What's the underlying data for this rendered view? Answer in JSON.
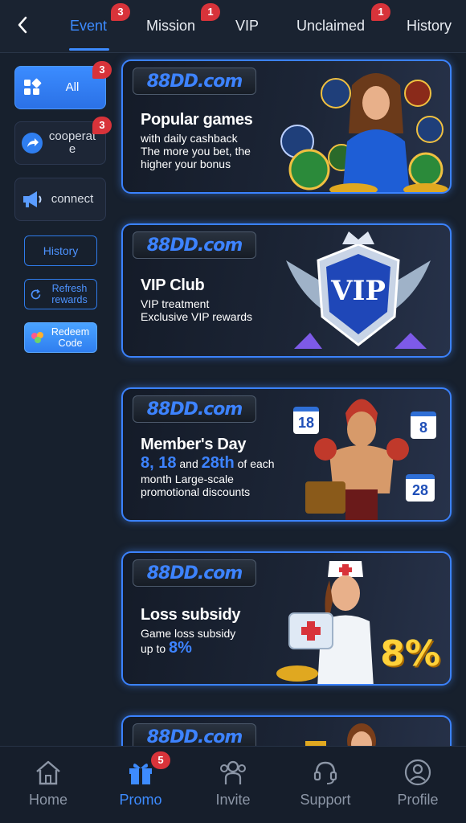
{
  "tabs": [
    {
      "label": "Event",
      "badge": "3"
    },
    {
      "label": "Mission",
      "badge": "1"
    },
    {
      "label": "VIP"
    },
    {
      "label": "Unclaimed",
      "badge": "1"
    },
    {
      "label": "History"
    }
  ],
  "sidebar": {
    "items": [
      {
        "label": "All",
        "badge": "3"
      },
      {
        "label": "cooperat e",
        "badge": "3"
      },
      {
        "label": "connect"
      }
    ],
    "history_label": "History",
    "refresh_label": "Refresh rewards",
    "redeem_label": "Redeem Code"
  },
  "banners": [
    {
      "logo": "88DD.com",
      "title": "Popular games",
      "lines": [
        "with daily cashback",
        "The more you bet, the",
        "higher your bonus"
      ]
    },
    {
      "logo": "88DD.com",
      "title": "VIP Club",
      "lines": [
        "VIP treatment",
        "Exclusive VIP rewards"
      ],
      "art_text": "VIP"
    },
    {
      "logo": "88DD.com",
      "title": "Member's Day",
      "line1_a": "8, 18",
      "line1_b": "and",
      "line1_c": "28th",
      "line1_d": "of each",
      "lines": [
        "month Large-scale",
        "promotional discounts"
      ],
      "dates": [
        "18",
        "8",
        "28"
      ]
    },
    {
      "logo": "88DD.com",
      "title": "Loss subsidy",
      "lines": [
        "Game loss subsidy"
      ],
      "line2_a": "up to",
      "line2_b": "8%",
      "art_text": "8%"
    },
    {
      "logo": "88DD.com"
    }
  ],
  "bottom_nav": [
    {
      "label": "Home"
    },
    {
      "label": "Promo",
      "badge": "5"
    },
    {
      "label": "Invite"
    },
    {
      "label": "Support"
    },
    {
      "label": "Profile"
    }
  ],
  "colors": {
    "accent": "#3d8bff",
    "badge": "#d8333a",
    "background": "#17202d"
  }
}
